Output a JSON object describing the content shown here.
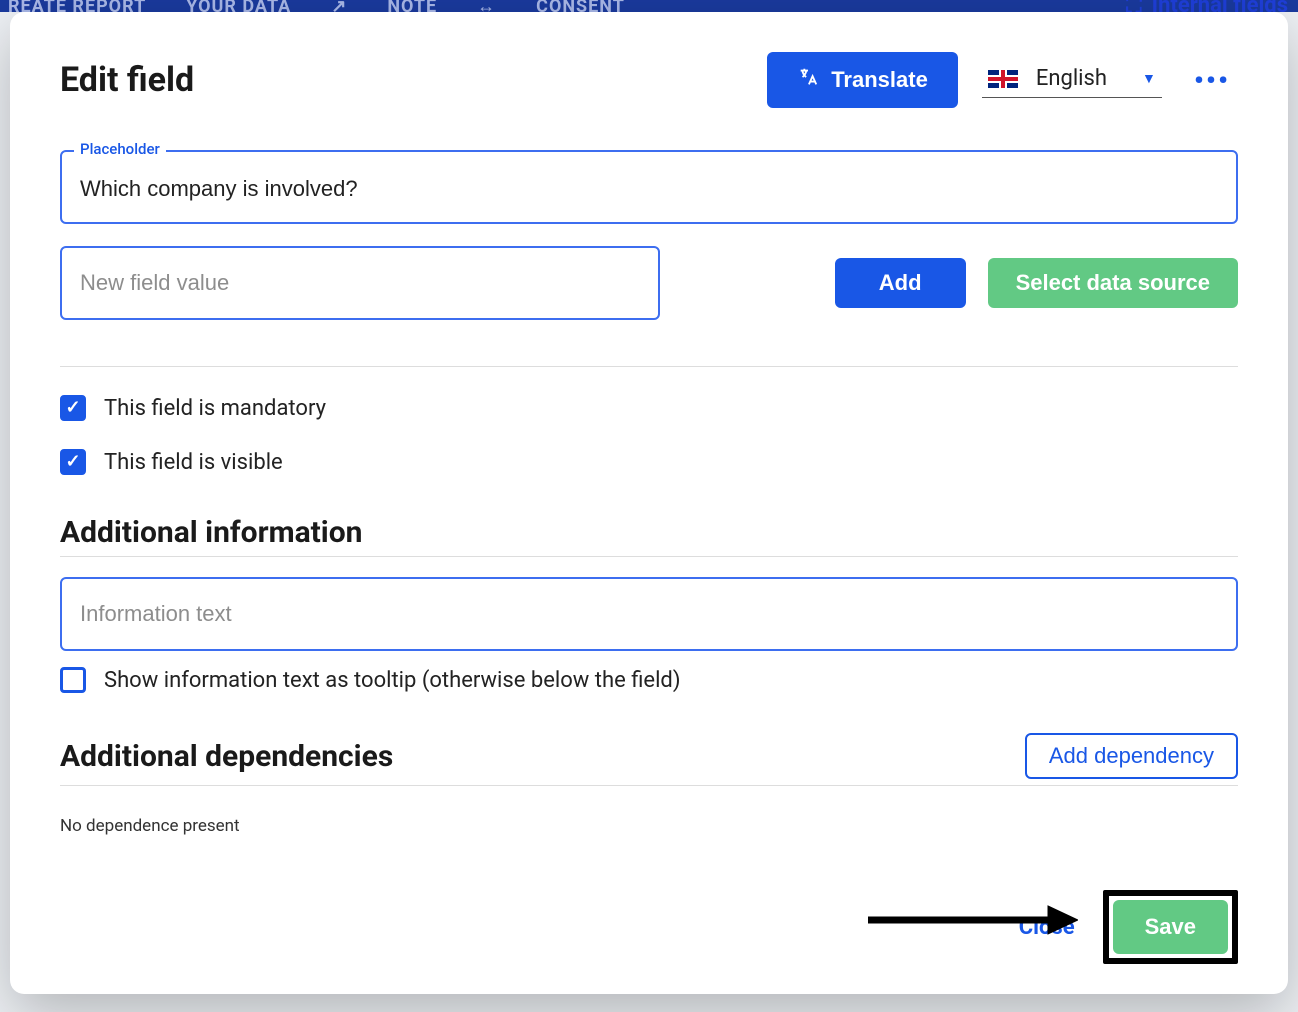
{
  "backdrop_tabs": [
    "REATE REPORT",
    "YOUR DATA",
    "NOTE",
    "CONSENT"
  ],
  "backdrop_right": "Internal fields",
  "modal_title": "Edit field",
  "translate_label": "Translate",
  "language": {
    "label": "English"
  },
  "placeholder_field": {
    "label": "Placeholder",
    "value": "Which company is involved?"
  },
  "new_value_placeholder": "New field value",
  "add_label": "Add",
  "select_ds_label": "Select data source",
  "mandatory_label": "This field is mandatory",
  "visible_label": "This field is visible",
  "additional_info_heading": "Additional information",
  "info_placeholder": "Information text",
  "tooltip_label": "Show information text as tooltip (otherwise below the field)",
  "dependencies_heading": "Additional dependencies",
  "add_dependency_label": "Add dependency",
  "no_dependence": "No dependence present",
  "close_label": "Close",
  "save_label": "Save"
}
